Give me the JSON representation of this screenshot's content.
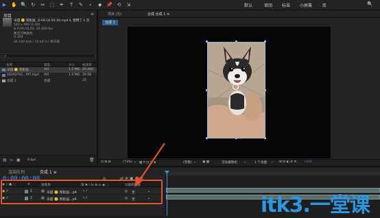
{
  "toolbar": {
    "tools": [
      "▶",
      "✋",
      "🔍",
      "↻",
      "⇔",
      "⬚",
      "✒",
      "T",
      "✎",
      "⬩",
      "◆",
      "📌",
      "⟲",
      "⇲"
    ],
    "workspaces": [
      "默认",
      "审阅",
      "标准",
      "小屏幕",
      "库"
    ],
    "active_workspace": "标准"
  },
  "project": {
    "tab": "项目",
    "file_title": "辛甜 🙂 贺影画 _6-09.18.50.10.mp4 ▾, 使用了 1 次",
    "info_lines": [
      "540 x 960 (1.00)",
      "Δ 0;00;10;02, 29.460 fps",
      "数百万种颜色",
      "H.264",
      "44.100 kHz / 32 bit U / 单声道"
    ],
    "search_placeholder": "ρ.",
    "columns": [
      "名称",
      "类型",
      "大小",
      "帧速率"
    ],
    "rows": [
      {
        "name": "辛甜 🙂 贺影画 ...",
        "type": "AVI",
        "size": "1.2 MB",
        "fps": "29.460",
        "selected": true
      },
      {
        "name": "16202701...9f7.mp4",
        "type": "AVI",
        "size": "1.9 MB",
        "fps": "29.98",
        "selected": false
      },
      {
        "name": "合成 1",
        "type": "合成",
        "size": "",
        "fps": "25",
        "selected": false
      }
    ],
    "bottom_label": "8 bpc"
  },
  "composition": {
    "tabs": [
      "项目 (无)",
      "合成 合成 1 ≡"
    ],
    "subtab": "合成 1",
    "viewer_bar": [
      "(73%)",
      "⌄",
      "(完整)",
      "⌄",
      "活动摄像机",
      "⌄",
      "1 个视图",
      "⌄",
      "+0.0"
    ]
  },
  "timeline": {
    "tabs": [
      "渲染队列",
      "合成 1 ≡"
    ],
    "timecode": "0;00;00;00",
    "header": [
      "#",
      "源名称",
      "单 ✱ \\ fx ⊞ ◎ ◉ ⬚",
      "父级和链接"
    ],
    "layers": [
      {
        "index": "1",
        "name": "辛甜 🙂 贺影画...p4",
        "parent": "无"
      },
      {
        "index": "2",
        "name": "辛甜 🙂 贺影画...p4",
        "parent": "无"
      }
    ]
  },
  "watermark": "itk3.一堂课",
  "colors": {
    "accent": "#3a9bf5",
    "highlight": "#e8502b",
    "watermark": "#2c97e1"
  }
}
